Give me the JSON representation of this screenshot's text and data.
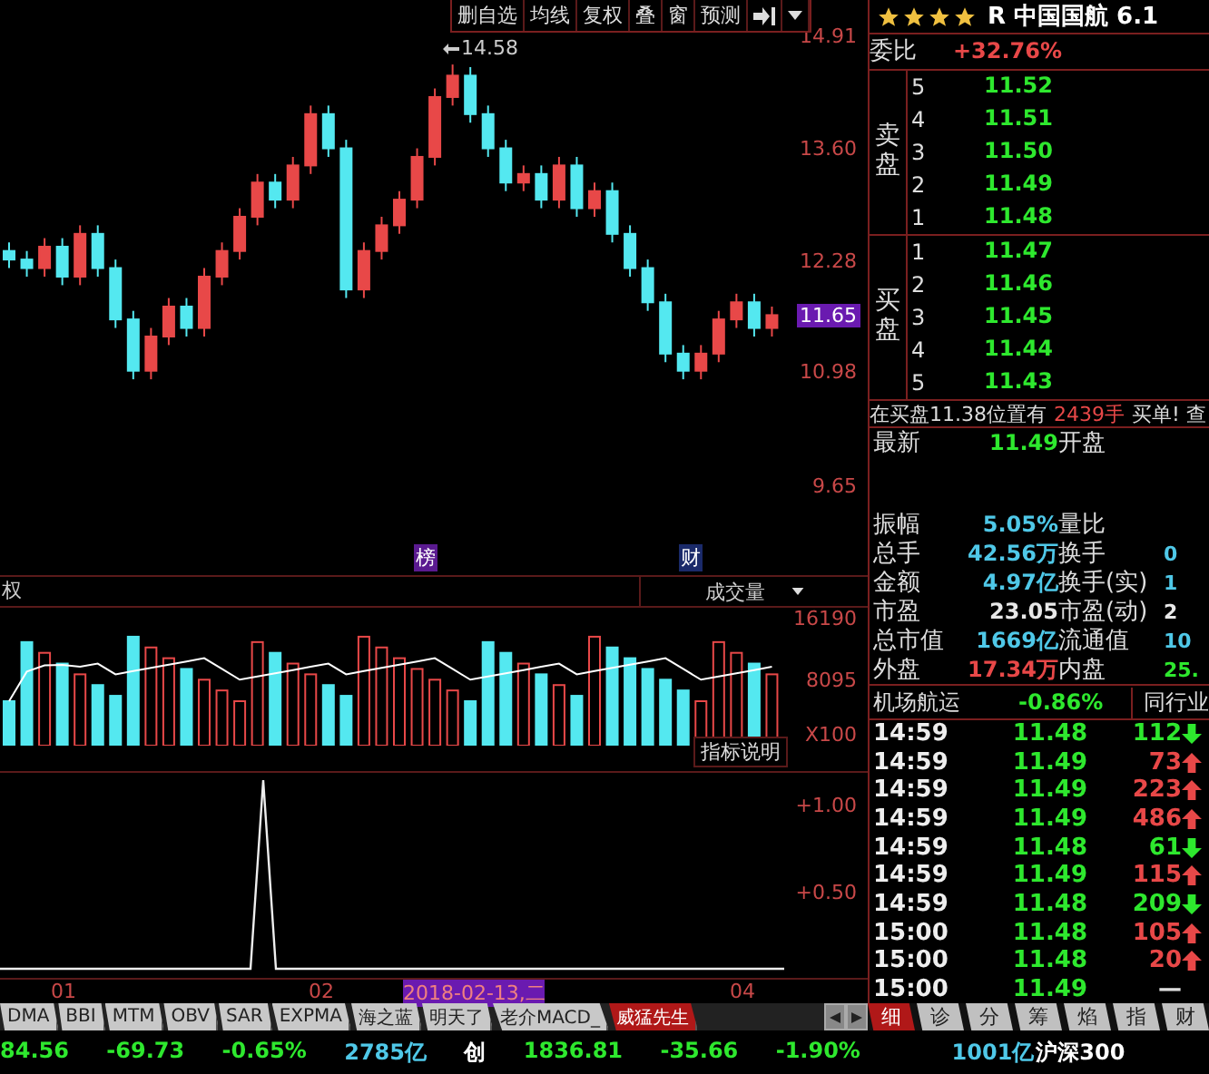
{
  "toolbar": {
    "buttons": [
      "删自选",
      "均线",
      "复权",
      "叠",
      "窗",
      "预测"
    ]
  },
  "price_chart": {
    "peak_label": "14.58",
    "current_price": "11.65",
    "markers": [
      "榜",
      "财"
    ],
    "chart_data": {
      "type": "candlestick",
      "categories": [
        null,
        null,
        null,
        null,
        null,
        null,
        null,
        null,
        null,
        null,
        null,
        null,
        null,
        null,
        null,
        null,
        null,
        null,
        null,
        null,
        null,
        null,
        null,
        null,
        null,
        null,
        null,
        null,
        null,
        null,
        null,
        null,
        null,
        null,
        null,
        null,
        null,
        null,
        null,
        null,
        null,
        null,
        null,
        null
      ],
      "ylim": [
        9.65,
        14.91
      ],
      "yticks": [
        {
          "value": 14.91,
          "label": "14.91"
        },
        {
          "value": 13.6,
          "label": "13.60"
        },
        {
          "value": 12.28,
          "label": "12.28"
        },
        {
          "value": 10.98,
          "label": "10.98"
        },
        {
          "value": 9.65,
          "label": "9.65"
        }
      ],
      "ohlc": [
        [
          12.4,
          12.5,
          12.2,
          12.3
        ],
        [
          12.3,
          12.4,
          12.1,
          12.2
        ],
        [
          12.2,
          12.55,
          12.1,
          12.45
        ],
        [
          12.45,
          12.55,
          12.0,
          12.1
        ],
        [
          12.1,
          12.7,
          12.0,
          12.6
        ],
        [
          12.6,
          12.7,
          12.1,
          12.2
        ],
        [
          12.2,
          12.3,
          11.5,
          11.6
        ],
        [
          11.6,
          11.7,
          10.9,
          11.0
        ],
        [
          11.0,
          11.5,
          10.9,
          11.4
        ],
        [
          11.4,
          11.85,
          11.3,
          11.75
        ],
        [
          11.75,
          11.85,
          11.4,
          11.5
        ],
        [
          11.5,
          12.2,
          11.4,
          12.1
        ],
        [
          12.1,
          12.5,
          12.0,
          12.4
        ],
        [
          12.4,
          12.9,
          12.3,
          12.8
        ],
        [
          12.8,
          13.3,
          12.7,
          13.2
        ],
        [
          13.2,
          13.3,
          12.9,
          13.0
        ],
        [
          13.0,
          13.5,
          12.9,
          13.4
        ],
        [
          13.4,
          14.1,
          13.3,
          14.0
        ],
        [
          14.0,
          14.1,
          13.5,
          13.6
        ],
        [
          13.6,
          13.7,
          11.85,
          11.95
        ],
        [
          11.95,
          12.5,
          11.85,
          12.4
        ],
        [
          12.4,
          12.8,
          12.3,
          12.7
        ],
        [
          12.7,
          13.1,
          12.6,
          13.0
        ],
        [
          13.0,
          13.6,
          12.9,
          13.5
        ],
        [
          13.5,
          14.3,
          13.4,
          14.2
        ],
        [
          14.2,
          14.58,
          14.1,
          14.45
        ],
        [
          14.45,
          14.55,
          13.9,
          14.0
        ],
        [
          14.0,
          14.1,
          13.5,
          13.6
        ],
        [
          13.6,
          13.7,
          13.1,
          13.2
        ],
        [
          13.2,
          13.4,
          13.1,
          13.3
        ],
        [
          13.3,
          13.4,
          12.9,
          13.0
        ],
        [
          13.0,
          13.5,
          12.9,
          13.4
        ],
        [
          13.4,
          13.5,
          12.8,
          12.9
        ],
        [
          12.9,
          13.2,
          12.8,
          13.1
        ],
        [
          13.1,
          13.2,
          12.5,
          12.6
        ],
        [
          12.6,
          12.7,
          12.1,
          12.2
        ],
        [
          12.2,
          12.3,
          11.7,
          11.8
        ],
        [
          11.8,
          11.9,
          11.1,
          11.2
        ],
        [
          11.2,
          11.3,
          10.9,
          11.0
        ],
        [
          11.0,
          11.3,
          10.9,
          11.2
        ],
        [
          11.2,
          11.7,
          11.1,
          11.6
        ],
        [
          11.6,
          11.9,
          11.5,
          11.8
        ],
        [
          11.8,
          11.9,
          11.4,
          11.5
        ],
        [
          11.5,
          11.75,
          11.4,
          11.65
        ]
      ]
    }
  },
  "volume_chart": {
    "left_label": "权",
    "indicator": "成交量",
    "axis_labels": [
      "16190",
      "8095",
      "X100"
    ],
    "help_button": "指标说明"
  },
  "indicator_chart": {
    "axis_labels": [
      "+1.00",
      "+0.50"
    ]
  },
  "date_axis": [
    {
      "text": "01",
      "highlighted": false
    },
    {
      "text": "02",
      "highlighted": false
    },
    {
      "text": "2018-02-13,二",
      "highlighted": true
    },
    {
      "text": "04",
      "highlighted": false
    }
  ],
  "indicator_tabs": [
    {
      "label": "DMA",
      "selected": false
    },
    {
      "label": "BBI",
      "selected": false
    },
    {
      "label": "MTM",
      "selected": false
    },
    {
      "label": "OBV",
      "selected": false
    },
    {
      "label": "SAR",
      "selected": false
    },
    {
      "label": "EXPMA",
      "selected": false
    },
    {
      "label": "海之蓝",
      "selected": false
    },
    {
      "label": "明天了",
      "selected": false
    },
    {
      "label": "老介MACD_",
      "selected": false
    },
    {
      "label": "威猛先生",
      "selected": true
    }
  ],
  "ticker": [
    {
      "text": "84.56",
      "color": "#2ee82e"
    },
    {
      "text": "-69.73",
      "color": "#2ee82e"
    },
    {
      "text": "-0.65%",
      "color": "#2ee82e"
    },
    {
      "text": "2785亿",
      "color": "#4fc8e8"
    },
    {
      "text": "创",
      "color": "#ffffff"
    },
    {
      "text": "1836.81",
      "color": "#2ee82e"
    },
    {
      "text": "-35.66",
      "color": "#2ee82e"
    },
    {
      "text": "-1.90%",
      "color": "#2ee82e"
    }
  ],
  "quote": {
    "stars": 4,
    "title": "R 中国国航 6.1",
    "ratio_label": "委比",
    "ratio": "+32.76%",
    "sell_label": "卖盘",
    "buy_label": "买盘",
    "sell": [
      {
        "rank": "5",
        "price": "11.52"
      },
      {
        "rank": "4",
        "price": "11.51"
      },
      {
        "rank": "3",
        "price": "11.50"
      },
      {
        "rank": "2",
        "price": "11.49"
      },
      {
        "rank": "1",
        "price": "11.48"
      }
    ],
    "buy": [
      {
        "rank": "1",
        "price": "11.47"
      },
      {
        "rank": "2",
        "price": "11.46"
      },
      {
        "rank": "3",
        "price": "11.45"
      },
      {
        "rank": "4",
        "price": "11.44"
      },
      {
        "rank": "5",
        "price": "11.43"
      }
    ]
  },
  "notice": {
    "text": "在买盘11.38位置有",
    "amount": "2439手",
    "tail": "买单! 查"
  },
  "stats": [
    {
      "label": "最新",
      "value": {
        "text": "11.49",
        "color": "#2ee82e"
      },
      "label2": "开盘"
    },
    {
      "label": "振幅",
      "value": {
        "text": "5.05%",
        "color": "#4fc8e8"
      },
      "label2": "量比"
    },
    {
      "label": "总手",
      "value": {
        "text": "42.56万",
        "color": "#4fc8e8"
      },
      "label2": "换手",
      "value2": {
        "text": "0",
        "color": "#4fc8e8"
      }
    },
    {
      "label": "金额",
      "value": {
        "text": "4.97亿",
        "color": "#4fc8e8"
      },
      "label2": "换手(实)",
      "value2": {
        "text": "1",
        "color": "#4fc8e8"
      }
    },
    {
      "label": "市盈",
      "value": {
        "text": "23.05",
        "color": "#e8e8e8"
      },
      "label2": "市盈(动)",
      "value2": {
        "text": "2",
        "color": "#e8e8e8"
      }
    },
    {
      "label": "总市值",
      "value": {
        "text": "1669亿",
        "color": "#4fc8e8"
      },
      "label2": "流通值",
      "value2": {
        "text": "10",
        "color": "#4fc8e8"
      }
    },
    {
      "label": "外盘",
      "value": {
        "text": "17.34万",
        "color": "#e84848"
      },
      "label2": "内盘",
      "value2": {
        "text": "25.",
        "color": "#2ee82e"
      }
    }
  ],
  "sector": {
    "name": "机场航运",
    "change": "-0.86%",
    "button": "同行业"
  },
  "ticks": [
    {
      "time": "14:59",
      "price": "11.48",
      "volume": "112",
      "kind": "down"
    },
    {
      "time": "14:59",
      "price": "11.49",
      "volume": "73",
      "kind": "up"
    },
    {
      "time": "14:59",
      "price": "11.49",
      "volume": "223",
      "kind": "up"
    },
    {
      "time": "14:59",
      "price": "11.49",
      "volume": "486",
      "kind": "up"
    },
    {
      "time": "14:59",
      "price": "11.48",
      "volume": "61",
      "kind": "down"
    },
    {
      "time": "14:59",
      "price": "11.49",
      "volume": "115",
      "kind": "up"
    },
    {
      "time": "14:59",
      "price": "11.48",
      "volume": "209",
      "kind": "down"
    },
    {
      "time": "15:00",
      "price": "11.48",
      "volume": "105",
      "kind": "up"
    },
    {
      "time": "15:00",
      "price": "11.48",
      "volume": "20",
      "kind": "up"
    },
    {
      "time": "15:00",
      "price": "11.49",
      "volume": "—",
      "kind": "flat"
    }
  ],
  "panel_tabs": [
    {
      "label": "细",
      "selected": true
    },
    {
      "label": "诊",
      "selected": false
    },
    {
      "label": "分",
      "selected": false
    },
    {
      "label": "筹",
      "selected": false
    },
    {
      "label": "焰",
      "selected": false
    },
    {
      "label": "指",
      "selected": false
    },
    {
      "label": "财",
      "selected": false
    }
  ],
  "index_ticker": {
    "amount": "1001亿",
    "name": "沪深300"
  }
}
